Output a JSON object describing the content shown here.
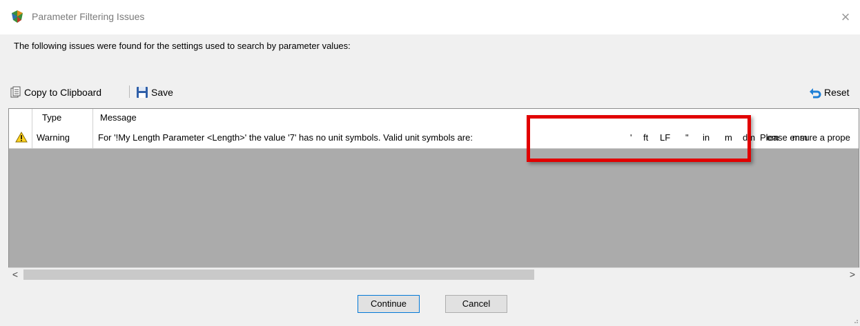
{
  "window": {
    "title": "Parameter Filtering Issues",
    "close_glyph": "×"
  },
  "description": "The following issues were found for the settings used to search by parameter values:",
  "toolbar": {
    "copy_label": "Copy to Clipboard",
    "save_label": "Save",
    "reset_label": "Reset"
  },
  "grid": {
    "columns": [
      "",
      "Type",
      "Message"
    ],
    "rows": [
      {
        "icon": "warning-icon",
        "type": "Warning",
        "message": "For '!My Length Parameter <Length>' the value '7' has no unit symbols.  Valid unit symbols are:",
        "units": [
          "'",
          "ft",
          "LF",
          "\"",
          "in",
          "m",
          "dm",
          "cm",
          "mm"
        ],
        "trailing": "Please ensure a prope"
      }
    ]
  },
  "scrollbar": {
    "left_glyph": "<",
    "right_glyph": ">"
  },
  "buttons": {
    "continue_label": "Continue",
    "cancel_label": "Cancel"
  },
  "colors": {
    "highlight": "#e10000",
    "grid_empty": "#ababab",
    "accent": "#0078d7"
  }
}
